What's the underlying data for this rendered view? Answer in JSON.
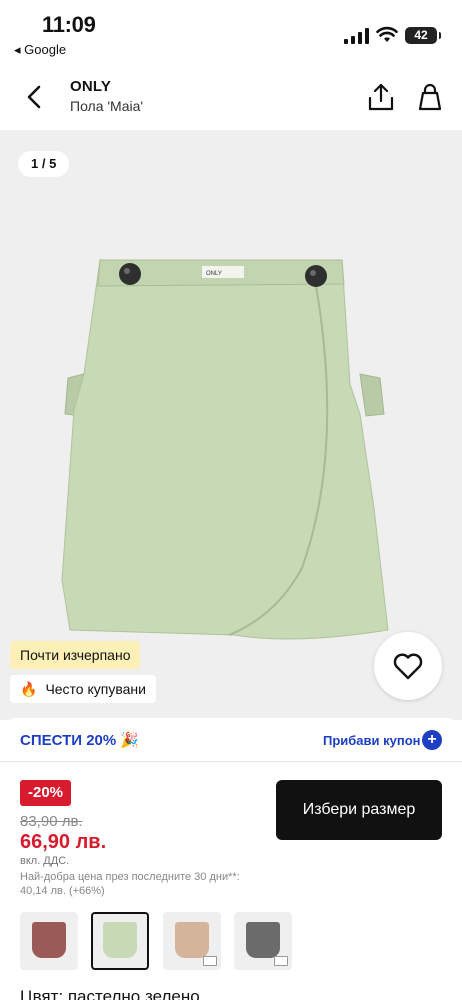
{
  "status_bar": {
    "time": "11:09",
    "back_app": "◂ Google",
    "battery": "42"
  },
  "header": {
    "brand": "ONLY",
    "product_name": "Пола 'Maia'"
  },
  "gallery": {
    "counter": "1 / 5",
    "skirt_brand_label": "ONLY",
    "tag_low_stock": "Почти изчерпано",
    "tag_popular": "Често купувани",
    "tag_popular_icon": "🔥",
    "product_color": "#c8d9b6"
  },
  "coupon": {
    "text": "СПЕСТИ 20% 🎉",
    "link": "Прибави купон",
    "plus": "+"
  },
  "price": {
    "discount": "-20%",
    "old": "83,90 лв.",
    "new": "66,90 лв.",
    "vat": "вкл. ДДС.",
    "best_price_note": "Най-добра цена през последните 30 дни**: 40,14 лв. (+66%)"
  },
  "actions": {
    "select_size": "Избери размер"
  },
  "variants": [
    {
      "name": "rose-brown",
      "color": "#9a5a57",
      "selected": false
    },
    {
      "name": "pastel-green",
      "color": "#c8d9b6",
      "selected": true
    },
    {
      "name": "beige",
      "color": "#d4b59c",
      "selected": false
    },
    {
      "name": "grey",
      "color": "#6b6b6b",
      "selected": false
    }
  ],
  "color_label": "Цвят: пастелно зелено",
  "colors": {
    "accent_blue": "#1d3fc4",
    "sale_red": "#d81b2d",
    "low_stock_bg": "#fdf0b6"
  }
}
